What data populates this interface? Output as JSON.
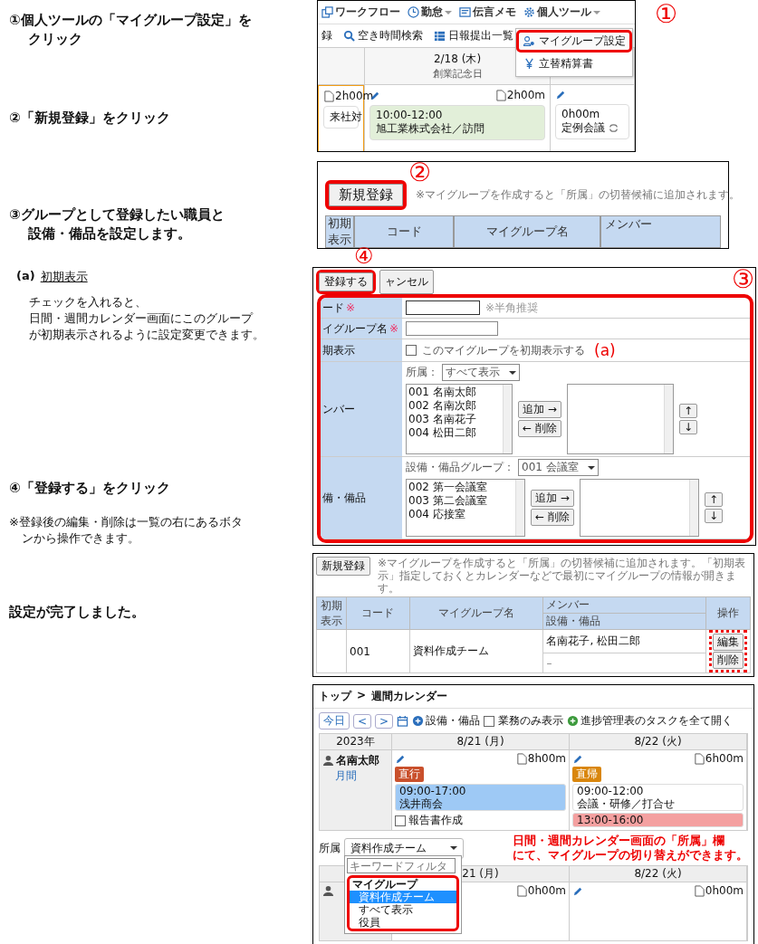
{
  "instructions": [
    {
      "kind": "step",
      "lines": [
        "①個人ツールの「マイグループ設定」を",
        "クリック"
      ]
    },
    {
      "kind": "step",
      "lines": [
        "②「新規登録」をクリック"
      ]
    },
    {
      "kind": "step",
      "lines": [
        "③グループとして登録したい職員と",
        "設備・備品を設定します。"
      ]
    },
    {
      "kind": "subhead",
      "label": "(a)",
      "text": "初期表示"
    },
    {
      "kind": "body",
      "lines": [
        "チェックを入れると、",
        "日間・週間カレンダー画面にこのグループ",
        "が初期表示されるように設定変更できます。"
      ]
    },
    {
      "kind": "step",
      "lines": [
        "④「登録する」をクリック"
      ]
    },
    {
      "kind": "note",
      "lines": [
        "※登録後の編集・削除は一覧の右にあるボタ",
        "ンから操作できます。"
      ]
    },
    {
      "kind": "step",
      "lines": [
        "設定が完了しました。"
      ]
    }
  ],
  "menu_screen": {
    "callout": "①",
    "nav": [
      {
        "label": "ワークフロー",
        "caret": false
      },
      {
        "label": "勤怠",
        "caret": true
      },
      {
        "label": "伝言メモ",
        "caret": false
      },
      {
        "label": "個人ツール",
        "caret": true
      }
    ],
    "toolbar": [
      "録",
      "空き時間検索",
      "日報提出一覧"
    ],
    "menu": [
      {
        "label": "マイグループ設定",
        "selected": true
      },
      {
        "label": "立替精算書",
        "selected": false
      }
    ],
    "days": [
      {
        "today": true,
        "edit": false,
        "duration": "2h00m",
        "events": [
          {
            "title": "来社対",
            "color": "#ffffff"
          }
        ]
      },
      {
        "today": false,
        "date": "2/18 (木)",
        "holiday": "創業記念日",
        "edit": true,
        "duration": "2h00m",
        "events": [
          {
            "time": "10:00-12:00",
            "title": "旭工業株式会社／訪問",
            "color": "#e2efd9"
          }
        ]
      },
      {
        "today": false,
        "edit": true,
        "events": [
          {
            "time": "0h00m",
            "title": "定例会議",
            "color": "#ffffff",
            "repeat": true
          }
        ]
      }
    ]
  },
  "register_screen": {
    "callout": "②",
    "button": "新規登録",
    "note": "※マイグループを作成すると「所属」の切替候補に追加されます。",
    "columns": [
      "初期表示",
      "コード",
      "マイグループ名",
      "メンバー"
    ]
  },
  "form_screen": {
    "step_callout": "④",
    "frame_callout": "③",
    "buttons": [
      "登録する",
      "ャンセル"
    ],
    "fields": [
      {
        "kind": "text",
        "label": "ード",
        "required": "※",
        "hint": "※半角推奨"
      },
      {
        "kind": "text",
        "label": "イグループ名",
        "required": "※"
      },
      {
        "kind": "checkbox",
        "label": "期表示",
        "text": "このマイグループを初期表示する",
        "checked": false,
        "callout": "(a)"
      }
    ],
    "pickers": [
      {
        "label": "ンバー",
        "filter_label": "所属：",
        "filter_value": "すべて表示",
        "items": [
          "001 名南太郎",
          "002 名南次郎",
          "003 名南花子",
          "004 松田二郎"
        ],
        "add": "追加 →",
        "remove": "← 削除",
        "up": "↑",
        "down": "↓"
      },
      {
        "label": "備・備品",
        "filter_label": "設備・備品グループ：",
        "filter_value": "001 会議室",
        "items": [
          "002 第一会議室",
          "003 第二会議室",
          "004 応接室"
        ],
        "add": "追加 →",
        "remove": "← 削除",
        "up": "↑",
        "down": "↓"
      }
    ]
  },
  "list_screen": {
    "button": "新規登録",
    "note": "※マイグループを作成すると「所属」の切替候補に追加されます。「初期表示」指定しておくとカレンダーなどで最初にマイグループの情報が開きます。",
    "columns": {
      "initial": "初期表示",
      "code": "コード",
      "name": "マイグループ名",
      "members": "メンバー",
      "equipment": "設備・備品",
      "actions": "操作"
    },
    "rows": [
      {
        "code": "001",
        "name": "資料作成チーム",
        "members": "名南花子, 松田二郎",
        "equipment": "–",
        "edit": "編集",
        "delete": "削除"
      }
    ]
  },
  "calendar_screen": {
    "breadcrumb": [
      "トップ",
      "週間カレンダー"
    ],
    "separator": ">",
    "toolbar": {
      "today": "今日",
      "prev": "<",
      "next": ">",
      "equipment": "設備・備品",
      "business_only": {
        "label": "業務のみ表示",
        "checked": false
      },
      "expand": "進捗管理表のタスクを全て開く"
    },
    "year": "2023年",
    "days": [
      "8/21 (月)",
      "8/22 (火)"
    ],
    "person": {
      "name": "名南太郎",
      "link": "月間"
    },
    "cells": [
      {
        "duration": "8h00m",
        "tag": {
          "label": "直行",
          "color": "#c9502c"
        },
        "events": [
          {
            "time": "09:00-17:00",
            "title": "浅井商会",
            "color": "#9ec9f5"
          }
        ],
        "tasks": [
          {
            "label": "報告書作成",
            "checked": false
          }
        ]
      },
      {
        "duration": "6h00m",
        "tag": {
          "label": "直帰",
          "color": "#d9860c"
        },
        "events": [
          {
            "time": "09:00-12:00",
            "title": "会議・研修／打合せ",
            "color": "#ffffff"
          },
          {
            "time": "13:00-16:00",
            "color": "#f4a0a0"
          }
        ]
      }
    ],
    "callout": [
      "日間・週間カレンダー画面の「所属」欄",
      "にて、マイグループの切り替えができます。"
    ],
    "group_select": {
      "label": "所属",
      "value": "資料作成チーム",
      "filter_placeholder": "キーワードフィルタ",
      "options": [
        {
          "kind": "group",
          "label": "マイグループ"
        },
        {
          "kind": "option",
          "label": "資料作成チーム",
          "selected": true
        },
        {
          "kind": "option",
          "label": "すべて表示",
          "selected": false
        },
        {
          "kind": "option",
          "label": "役員",
          "selected": false
        }
      ]
    },
    "lower_days": [
      "21 (月)",
      "8/22 (火)"
    ],
    "lower_durations": [
      "0h00m",
      "0h00m"
    ]
  }
}
